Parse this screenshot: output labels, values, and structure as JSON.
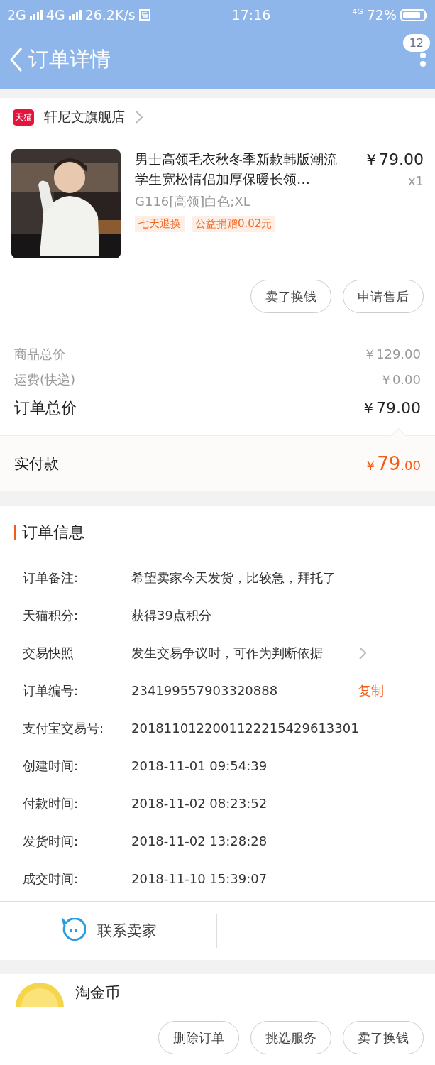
{
  "status_bar": {
    "network_1": "2G",
    "network_2": "4G",
    "speed": "26.2K/s",
    "time": "17:16",
    "network_3": "4G",
    "battery": "72%"
  },
  "nav": {
    "title": "订单详情",
    "badge": "12"
  },
  "shop": {
    "logo": "天猫",
    "name": "轩尼文旗舰店"
  },
  "item": {
    "kind": "picture",
    "title": "男士高领毛衣秋冬季新款韩版潮流学生宽松情侣加厚保暖长领…",
    "price": "￥79.00",
    "quantity": "x1",
    "sku": "G116[高领]白色;XL",
    "tags": [
      "七天退换",
      "公益捐赠0.02元"
    ],
    "buttons": [
      "卖了换钱",
      "申请售后"
    ]
  },
  "summary": {
    "rows": [
      {
        "label": "商品总价",
        "value": "￥129.00",
        "kind": "minor"
      },
      {
        "label": "运费(快递)",
        "value": "￥0.00",
        "kind": "minor"
      },
      {
        "label": "订单总价",
        "value": "￥79.00",
        "kind": "major"
      }
    ],
    "paid": {
      "label": "实付款",
      "currency": "￥",
      "integer": "79",
      "decimal": ".00"
    }
  },
  "order_info": {
    "title": "订单信息",
    "rows": [
      {
        "label": "订单备注:",
        "value": "希望卖家今天发货，比较急，拜托了",
        "kind": "text"
      },
      {
        "label": "天猫积分:",
        "value": "获得39点积分",
        "kind": "text"
      },
      {
        "label": "交易快照",
        "value": "发生交易争议时，可作为判断依据",
        "kind": "link"
      },
      {
        "label": "订单编号:",
        "value": "234199557903320888",
        "kind": "copy",
        "action": "复制"
      },
      {
        "label": "支付宝交易号:",
        "value": "2018110122001122215429613301",
        "kind": "text"
      },
      {
        "label": "创建时间:",
        "value": "2018-11-01 09:54:39",
        "kind": "text"
      },
      {
        "label": "付款时间:",
        "value": "2018-11-02 08:23:52",
        "kind": "text"
      },
      {
        "label": "发货时间:",
        "value": "2018-11-02 13:28:28",
        "kind": "text"
      },
      {
        "label": "成交时间:",
        "value": "2018-11-10 15:39:07",
        "kind": "text"
      }
    ]
  },
  "contact": {
    "label": "联系卖家"
  },
  "coins": {
    "label": "淘金币"
  },
  "bottom_buttons": [
    "删除订单",
    "挑选服务",
    "卖了换钱"
  ]
}
